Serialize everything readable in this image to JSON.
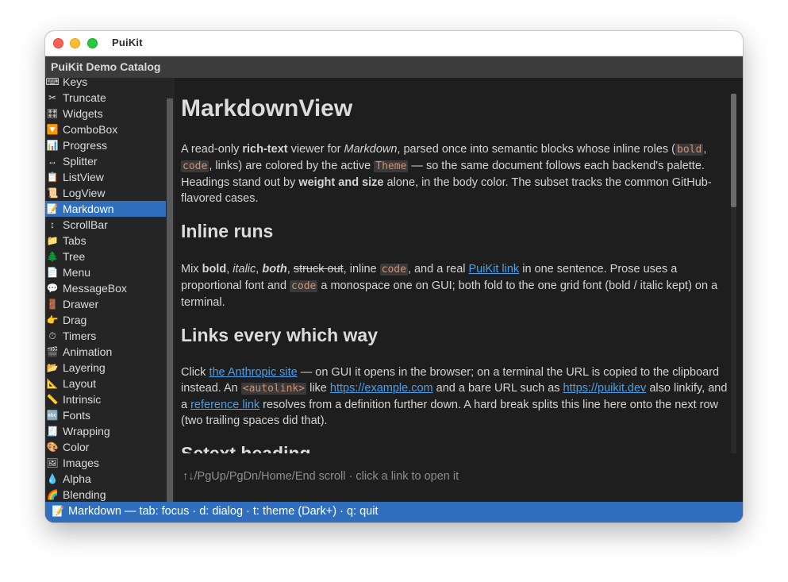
{
  "window": {
    "title": "PuiKit"
  },
  "app": {
    "title": "PuiKit Demo Catalog"
  },
  "sidebar": {
    "selected": "Markdown",
    "items": [
      {
        "label": "Keys",
        "icon": "keyboard-icon",
        "glyph": "⌨"
      },
      {
        "label": "Truncate",
        "icon": "scissors-icon",
        "glyph": "✂"
      },
      {
        "label": "Widgets",
        "icon": "control-knobs-icon",
        "glyph": "🎛"
      },
      {
        "label": "ComboBox",
        "icon": "dropdown-arrow-icon",
        "glyph": "🔽"
      },
      {
        "label": "Progress",
        "icon": "bar-chart-icon",
        "glyph": "📊"
      },
      {
        "label": "Splitter",
        "icon": "left-right-arrow-icon",
        "glyph": "↔"
      },
      {
        "label": "ListView",
        "icon": "list-icon",
        "glyph": "📋"
      },
      {
        "label": "LogView",
        "icon": "scroll-icon",
        "glyph": "📜"
      },
      {
        "label": "Markdown",
        "icon": "memo-icon",
        "glyph": "📝"
      },
      {
        "label": "ScrollBar",
        "icon": "up-down-arrow-icon",
        "glyph": "↕"
      },
      {
        "label": "Tabs",
        "icon": "folder-icon",
        "glyph": "📁"
      },
      {
        "label": "Tree",
        "icon": "tree-icon",
        "glyph": "🌲"
      },
      {
        "label": "Menu",
        "icon": "menu-icon",
        "glyph": "📄"
      },
      {
        "label": "MessageBox",
        "icon": "speech-bubble-icon",
        "glyph": "💬"
      },
      {
        "label": "Drawer",
        "icon": "door-icon",
        "glyph": "🚪"
      },
      {
        "label": "Drag",
        "icon": "drag-hand-icon",
        "glyph": "👉"
      },
      {
        "label": "Timers",
        "icon": "stopwatch-icon",
        "glyph": "⏱"
      },
      {
        "label": "Animation",
        "icon": "clapper-icon",
        "glyph": "🎬"
      },
      {
        "label": "Layering",
        "icon": "folders-icon",
        "glyph": "📂"
      },
      {
        "label": "Layout",
        "icon": "triangle-ruler-icon",
        "glyph": "📐"
      },
      {
        "label": "Intrinsic",
        "icon": "ruler-icon",
        "glyph": "📏"
      },
      {
        "label": "Fonts",
        "icon": "abc-icon",
        "glyph": "🔤"
      },
      {
        "label": "Wrapping",
        "icon": "text-wrap-icon",
        "glyph": "🧾"
      },
      {
        "label": "Color",
        "icon": "palette-icon",
        "glyph": "🎨"
      },
      {
        "label": "Images",
        "icon": "picture-icon",
        "glyph": "🖼"
      },
      {
        "label": "Alpha",
        "icon": "droplet-icon",
        "glyph": "💧"
      },
      {
        "label": "Blending",
        "icon": "rainbow-icon",
        "glyph": "🌈"
      }
    ]
  },
  "doc": {
    "h1": "MarkdownView",
    "intro": {
      "t1": "A read-only ",
      "b1": "rich-text",
      "t2": " viewer for ",
      "i1": "Markdown",
      "t3": ", parsed once into semantic blocks whose inline roles (",
      "c1": "bold",
      "t4": ", ",
      "c2": "code",
      "t5": ", links) are colored by the active ",
      "c3": "Theme",
      "t6": " — so the same document follows each backend's palette. Headings stand out by ",
      "b2": "weight and size",
      "t7": " alone, in the body color. The subset tracks the common GitHub-flavored cases."
    },
    "h2_inline": "Inline runs",
    "inline": {
      "t1": "Mix ",
      "b1": "bold",
      "t2": ", ",
      "i1": "italic",
      "t3": ", ",
      "bi1": "both",
      "t4": ", ",
      "s1": "struck out",
      "t5": ", inline ",
      "c1": "code",
      "t6": ", and a real ",
      "l1": "PuiKit link",
      "t7": " in one sentence. Prose uses a proportional font and ",
      "c2": "code",
      "t8": " a monospace one on GUI; both fold to the one grid font (bold / italic kept) on a terminal."
    },
    "h2_links": "Links every which way",
    "links": {
      "t1": "Click ",
      "l1": "the Anthropic site",
      "t2": " — on GUI it opens in the browser; on a terminal the URL is copied to the clipboard instead. An ",
      "c1": "<autolink>",
      "t3": " like ",
      "l2": "https://example.com",
      "t4": " and a bare URL such as ",
      "l3": "https://puikit.dev",
      "t5": " also linkify, and a ",
      "l4": "reference link",
      "t6": " resolves from a definition further down. A hard break splits this line here onto the next row (two trailing spaces did that)."
    },
    "h2_setext": "Setext heading"
  },
  "hint": "↑↓/PgUp/PgDn/Home/End scroll · click a link to open it",
  "status": {
    "icon": "memo-icon",
    "glyph": "📝",
    "text": "Markdown — tab: focus · d: dialog · t: theme (Dark+) · q: quit"
  },
  "colors": {
    "accent": "#2f6fbd",
    "link": "#4a9fe8",
    "code_text": "#ce9178",
    "background": "#1e1e1e"
  }
}
